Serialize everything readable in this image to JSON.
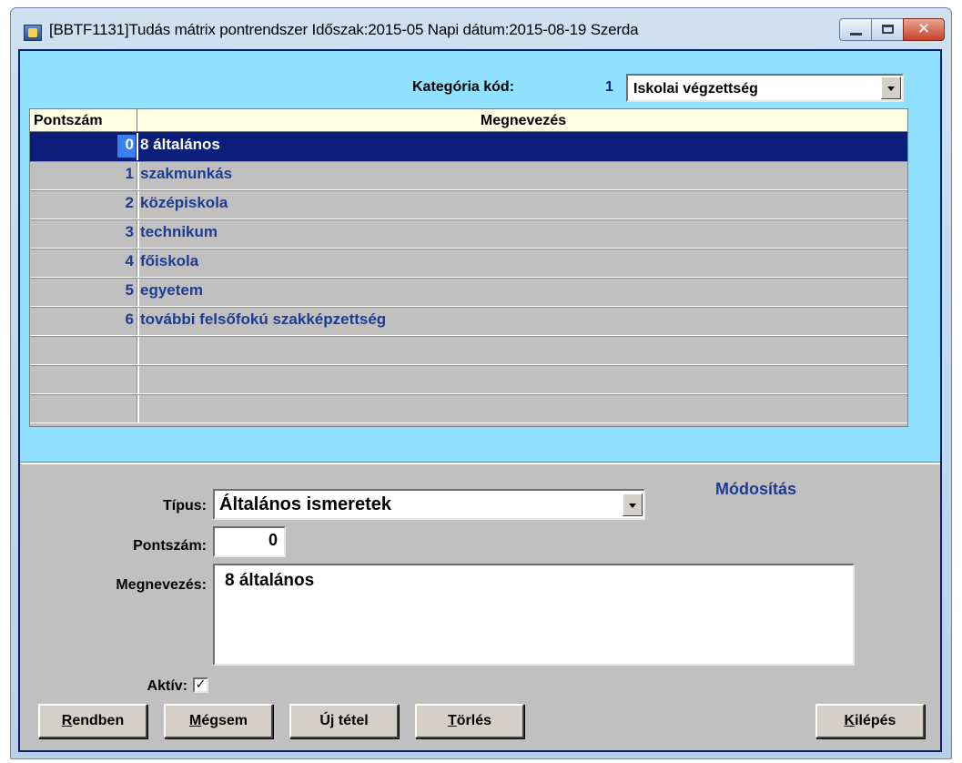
{
  "window": {
    "title": "[BBTF1131]Tudás mátrix pontrendszer Időszak:2015-05 Napi dátum:2015-08-19 Szerda"
  },
  "category": {
    "label": "Kategória kód:",
    "code": "1",
    "selected": "Iskolai végzettség"
  },
  "grid": {
    "columns": [
      "Pontszám",
      "Megnevezés"
    ],
    "rows": [
      {
        "pontszam": "0",
        "megnevezes": "8 általános"
      },
      {
        "pontszam": "1",
        "megnevezes": "szakmunkás"
      },
      {
        "pontszam": "2",
        "megnevezes": "középiskola"
      },
      {
        "pontszam": "3",
        "megnevezes": "technikum"
      },
      {
        "pontszam": "4",
        "megnevezes": "főiskola"
      },
      {
        "pontszam": "5",
        "megnevezes": "egyetem"
      },
      {
        "pontszam": "6",
        "megnevezes": "további felsőfokú szakképzettség"
      },
      {
        "pontszam": "",
        "megnevezes": ""
      },
      {
        "pontszam": "",
        "megnevezes": ""
      },
      {
        "pontszam": "",
        "megnevezes": ""
      }
    ],
    "selected_index": 0
  },
  "form": {
    "mode": "Módosítás",
    "tipus_label": "Típus:",
    "tipus_value": "Általános ismeretek",
    "pontszam_label": "Pontszám:",
    "pontszam_value": "0",
    "megnevezes_label": "Megnevezés:",
    "megnevezes_value": "8 általános",
    "aktiv_label": "Aktív:",
    "aktiv_checked": true
  },
  "buttons": {
    "rendben": {
      "accel": "R",
      "rest": "endben"
    },
    "megsem": {
      "accel": "M",
      "rest": "égsem"
    },
    "uj_tetel": "Új tétel",
    "torles": {
      "accel": "T",
      "rest": "örlés"
    },
    "kilepes": {
      "accel": "K",
      "rest": "ilépés"
    }
  },
  "colors": {
    "client_top": "#8fe1ff",
    "selection": "#0b1f7a",
    "text_blue": "#1f3a93",
    "grid_header": "#ffffe4"
  }
}
